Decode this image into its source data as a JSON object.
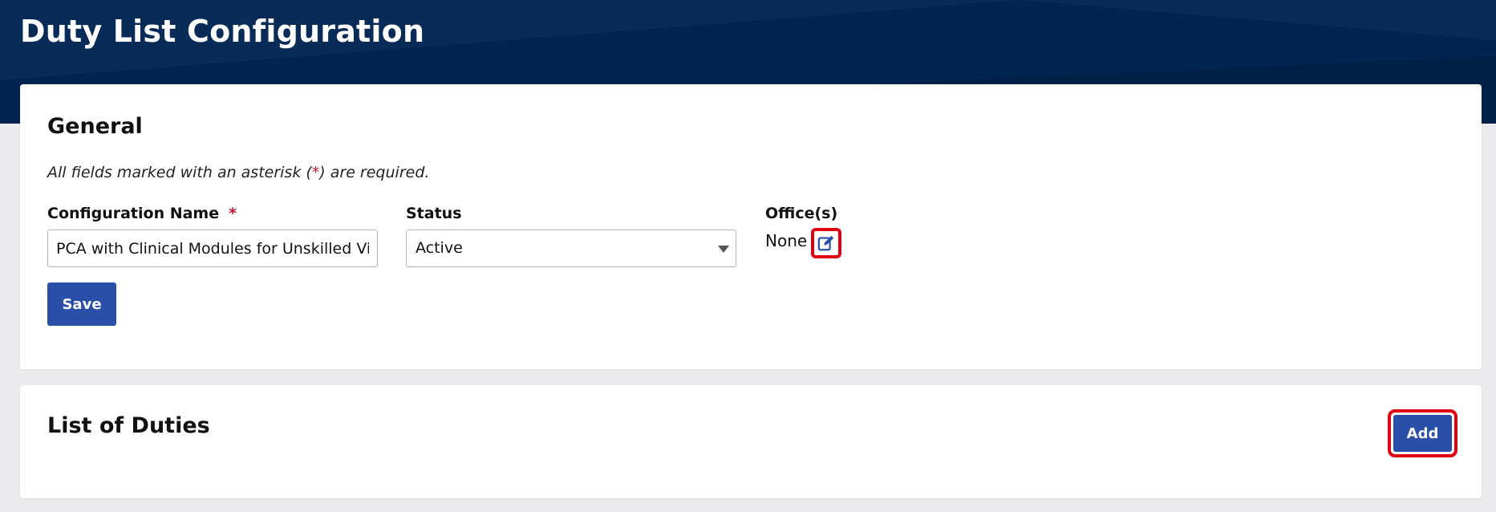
{
  "page": {
    "title": "Duty List Configuration"
  },
  "general": {
    "title": "General",
    "required_note_before": "All fields marked with an asterisk (",
    "required_note_asterisk": "*",
    "required_note_after": ") are required.",
    "config_name": {
      "label": "Configuration Name",
      "required_marker": "*",
      "value": "PCA with Clinical Modules for Unskilled Visi"
    },
    "status": {
      "label": "Status",
      "selected": "Active"
    },
    "offices": {
      "label": "Office(s)",
      "value": "None"
    },
    "save_label": "Save"
  },
  "duties": {
    "title": "List of Duties",
    "add_label": "Add"
  },
  "colors": {
    "header_bg": "#002147",
    "primary_button": "#2a4fa8",
    "required_red": "#c8102e",
    "highlight_border": "#e00012"
  },
  "icons": {
    "office_edit": "edit-icon",
    "status_caret": "caret-down-icon"
  }
}
